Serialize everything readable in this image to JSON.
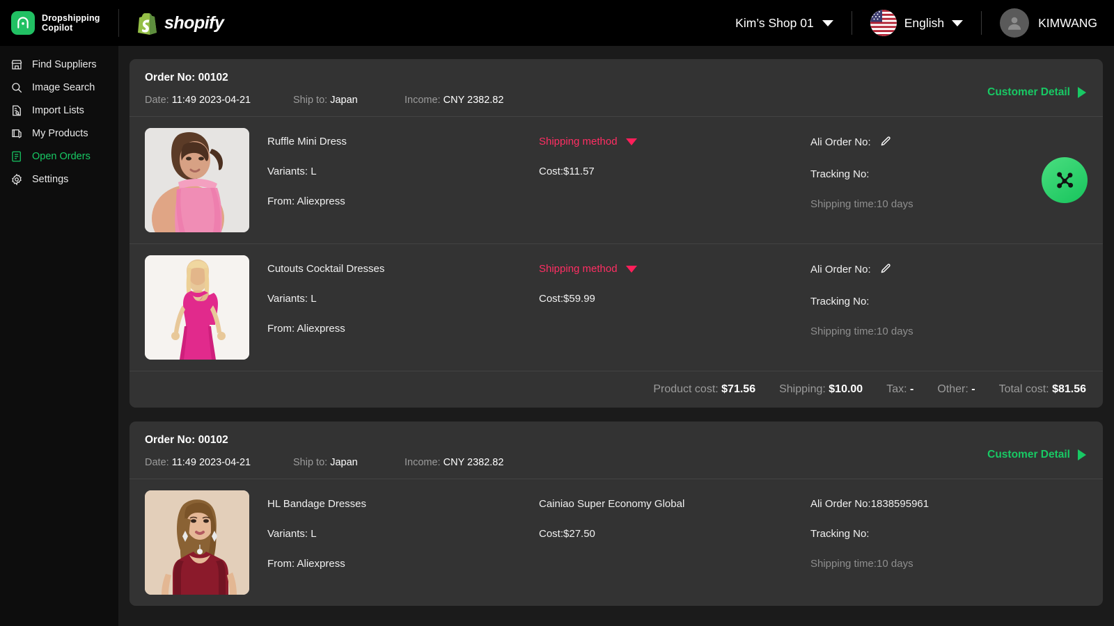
{
  "brand": {
    "name_line1": "Dropshipping",
    "name_line2": "Copilot",
    "logo_icon": "app-logo-icon",
    "partner_name": "shopify",
    "partner_icon": "shopify-bag-icon",
    "accent": "#21c063"
  },
  "header": {
    "shop_selector": "Kim’s Shop 01",
    "shop_caret_icon": "chevron-down-icon",
    "language": "English",
    "language_flag_icon": "us-flag-icon",
    "language_caret_icon": "chevron-down-icon",
    "user_name": "KIMWANG",
    "user_avatar_icon": "person-icon"
  },
  "sidebar": {
    "items": [
      {
        "label": "Find Suppliers",
        "icon": "storefront-icon",
        "active": false
      },
      {
        "label": "Image Search",
        "icon": "search-icon",
        "active": false
      },
      {
        "label": "Import Lists",
        "icon": "document-list-icon",
        "active": false
      },
      {
        "label": "My Products",
        "icon": "tag-products-icon",
        "active": false
      },
      {
        "label": "Open Orders",
        "icon": "orders-icon",
        "active": true
      },
      {
        "label": "Settings",
        "icon": "gear-icon",
        "active": false
      }
    ],
    "active_color": "#18c964"
  },
  "labels": {
    "order_no": "Order No:",
    "date": "Date:",
    "ship_to": "Ship to:",
    "income": "Income:",
    "customer_detail": "Customer Detail",
    "customer_detail_icon": "triangle-right-icon",
    "variants": "Variants:",
    "from": "From:",
    "shipping_method": "Shipping method",
    "shipping_method_icon": "chevron-down-icon",
    "ali_order_no": "Ali Order No:",
    "ali_edit_icon": "pencil-edit-icon",
    "tracking_no": "Tracking No:",
    "product_cost": "Product cost:",
    "shipping": "Shipping:",
    "tax": "Tax:",
    "other": "Other:",
    "total_cost": "Total cost:",
    "fab_icon": "share-nodes-icon"
  },
  "orders": [
    {
      "order_no": "00102",
      "date": "11:49 2023-04-21",
      "ship_to": "Japan",
      "income": "CNY 2382.82",
      "items": [
        {
          "title": "Ruffle Mini Dress",
          "variant": "L",
          "source": "Aliexpress",
          "shipping_method_label": "Shipping method",
          "shipping_method_is_dropdown": true,
          "cost": "Cost:$11.57",
          "ali_order_no": "",
          "tracking_no": "",
          "shipping_time": "Shipping time:10 days",
          "image": "pink-halter-dress-model",
          "has_fab": true
        },
        {
          "title": "Cutouts Cocktail Dresses",
          "variant": "L",
          "source": "Aliexpress",
          "shipping_method_label": "Shipping method",
          "shipping_method_is_dropdown": true,
          "cost": "Cost:$59.99",
          "ali_order_no": "",
          "tracking_no": "",
          "shipping_time": "Shipping time:10 days",
          "image": "magenta-cocktail-dress-model",
          "has_fab": false
        }
      ],
      "totals": {
        "product_cost": "$71.56",
        "shipping": "$10.00",
        "tax": "-",
        "other": "-",
        "total_cost": "$81.56"
      }
    },
    {
      "order_no": "00102",
      "date": "11:49 2023-04-21",
      "ship_to": "Japan",
      "income": "CNY 2382.82",
      "items": [
        {
          "title": "HL Bandage Dresses",
          "variant": "L",
          "source": "Aliexpress",
          "shipping_method_label": "Cainiao Super Economy Global",
          "shipping_method_is_dropdown": false,
          "cost": "Cost:$27.50",
          "ali_order_no": "Ali Order No:1838595961",
          "tracking_no": "",
          "shipping_time": "Shipping time:10 days",
          "image": "burgundy-bandage-dress-model",
          "has_fab": false
        }
      ]
    }
  ]
}
